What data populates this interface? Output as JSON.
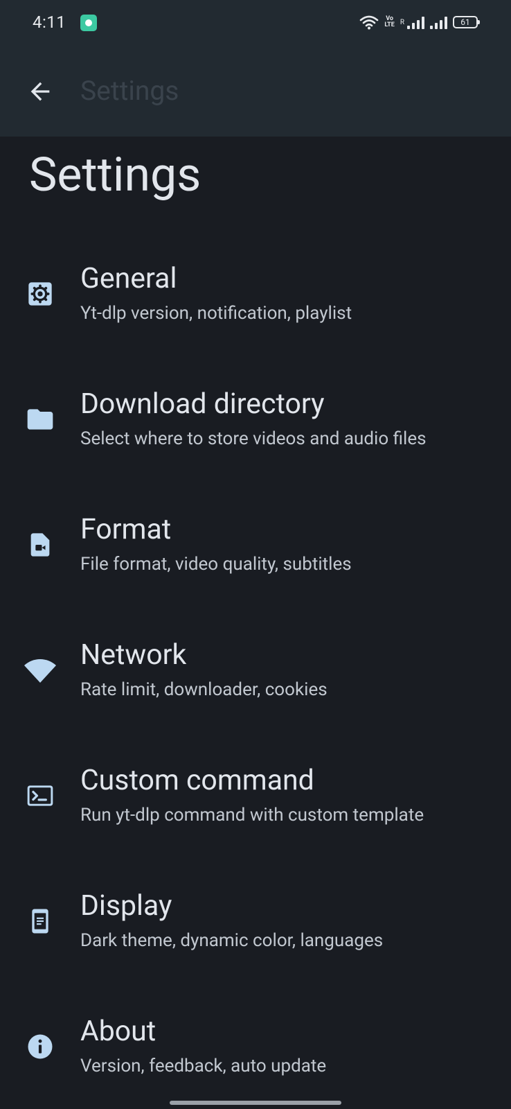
{
  "status_bar": {
    "time": "4:11",
    "volte": "Vo\nLTE",
    "roaming": "R",
    "battery": "61"
  },
  "toolbar": {
    "title": "Settings"
  },
  "page_title": "Settings",
  "colors": {
    "icon": "#bcd8f1",
    "background": "#191c22",
    "toolbar_background": "#222a31"
  },
  "settings": [
    {
      "icon": "gear-icon",
      "title": "General",
      "subtitle": "Yt-dlp version, notification, playlist"
    },
    {
      "icon": "folder-icon",
      "title": "Download directory",
      "subtitle": "Select where to store videos and audio files"
    },
    {
      "icon": "video-file-icon",
      "title": "Format",
      "subtitle": "File format, video quality, subtitles"
    },
    {
      "icon": "wifi-icon",
      "title": "Network",
      "subtitle": "Rate limit, downloader, cookies"
    },
    {
      "icon": "terminal-icon",
      "title": "Custom command",
      "subtitle": "Run yt-dlp command with custom template"
    },
    {
      "icon": "display-icon",
      "title": "Display",
      "subtitle": "Dark theme, dynamic color, languages"
    },
    {
      "icon": "info-icon",
      "title": "About",
      "subtitle": "Version, feedback, auto update"
    }
  ]
}
